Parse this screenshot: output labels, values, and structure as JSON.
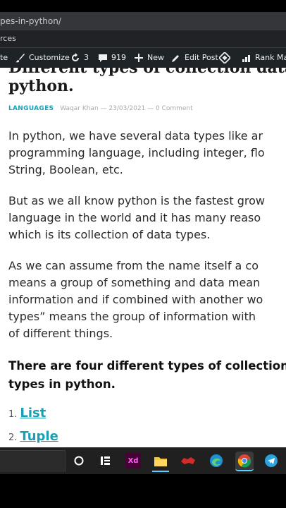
{
  "browser": {
    "url_fragment": "pes-in-python/",
    "bookmark_fragment": "rces"
  },
  "admin_bar": {
    "items": [
      {
        "label": "te"
      },
      {
        "label": "Customize"
      },
      {
        "label": "3"
      },
      {
        "label": "919"
      },
      {
        "label": "New"
      },
      {
        "label": "Edit Post"
      },
      {
        "label": "Rank Ma"
      }
    ]
  },
  "article": {
    "title_line1": "Different types of collection data type",
    "title_line2": "python.",
    "meta_category": "LANGUAGES",
    "meta_rest": "Waqar Khan — 23/03/2021 — 0 Comment",
    "p1": [
      "In python, we have several data types like ar",
      "programming language, including integer, flo",
      "String, Boolean, etc."
    ],
    "p2": [
      "But as we all know python is the fastest grow",
      "language in the world and it has many reaso",
      "which is its collection of data types."
    ],
    "p3": [
      "As we can assume from the name itself a co",
      "means a group of something and data mean",
      "information and if combined with another wo",
      "types” means the group of information with",
      "of different things."
    ],
    "heading_lines": [
      "There are four different types of collection",
      "types in python."
    ],
    "list": [
      {
        "num": "1.",
        "label": "List"
      },
      {
        "num": "2.",
        "label": "Tuple"
      }
    ]
  },
  "taskbar": {
    "xd_label": "Xd"
  }
}
